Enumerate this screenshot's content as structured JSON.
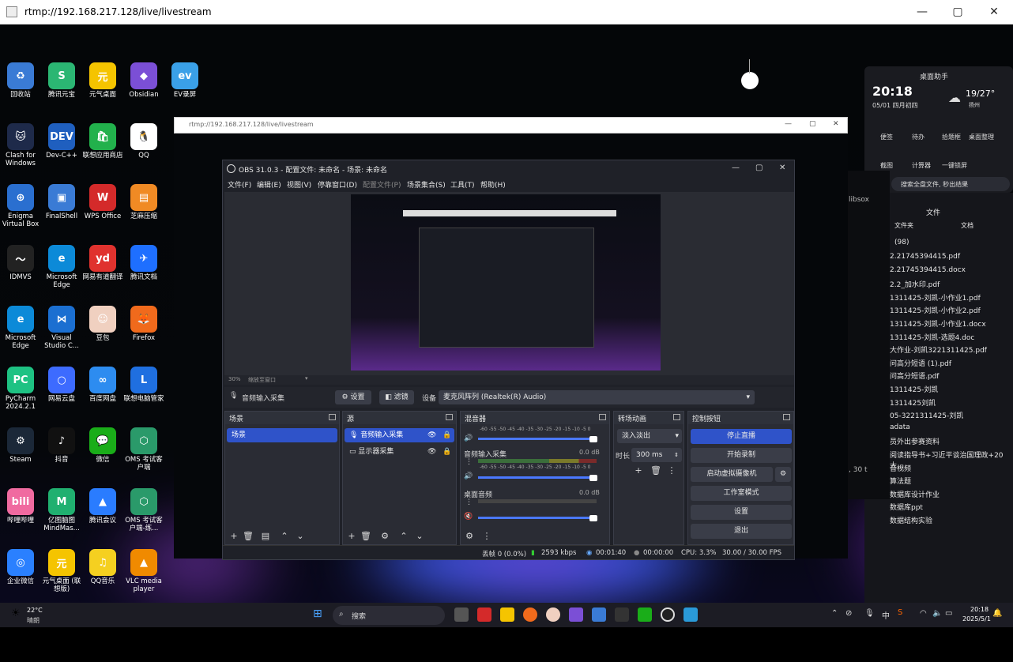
{
  "outer_window": {
    "title": "rtmp://192.168.217.128/live/livestream",
    "min": "—",
    "max": "▢",
    "close": "✕"
  },
  "desktop_icons": [
    {
      "label": "回收站",
      "color": "#3a7bd5",
      "glyph": "♻",
      "x": 0,
      "y": 0
    },
    {
      "label": "腾讯元宝",
      "color": "#2bb673",
      "glyph": "S"
    },
    {
      "label": "元气桌面",
      "color": "#f5c400",
      "glyph": "元"
    },
    {
      "label": "Obsidian",
      "color": "#7b4fd6",
      "glyph": "◆"
    },
    {
      "label": "EV录屏",
      "color": "#3aa0e8",
      "glyph": "ev"
    },
    {
      "label": "Clash for Windows",
      "color": "#1e2a4a",
      "glyph": "🐱"
    },
    {
      "label": "Dev-C++",
      "color": "#1f5fbf",
      "glyph": "DEV"
    },
    {
      "label": "联想应用商店",
      "color": "#22b14c",
      "glyph": "🛍"
    },
    {
      "label": "QQ",
      "color": "#ffffff",
      "glyph": "🐧"
    },
    {
      "label": "Enigma Virtual Box",
      "color": "#2a6fd0",
      "glyph": "⊕"
    },
    {
      "label": "FinalShell",
      "color": "#3a7bd5",
      "glyph": "▣"
    },
    {
      "label": "WPS Office",
      "color": "#d42a2a",
      "glyph": "W"
    },
    {
      "label": "芝麻压缩",
      "color": "#f08a24",
      "glyph": "▤"
    },
    {
      "label": "IDMVS",
      "color": "#222",
      "glyph": "〜"
    },
    {
      "label": "Microsoft Edge",
      "color": "#0c8ad8",
      "glyph": "e"
    },
    {
      "label": "网易有道翻译",
      "color": "#e0322e",
      "glyph": "yd"
    },
    {
      "label": "腾讯文档",
      "color": "#1e6fff",
      "glyph": "✈"
    },
    {
      "label": "Microsoft Edge",
      "color": "#0c8ad8",
      "glyph": "e"
    },
    {
      "label": "Visual Studio C...",
      "color": "#1b6fd1",
      "glyph": "⋈"
    },
    {
      "label": "豆包",
      "color": "#f0d0c0",
      "glyph": "☺"
    },
    {
      "label": "Firefox",
      "color": "#f06a1c",
      "glyph": "🦊"
    },
    {
      "label": "PyCharm 2024.2.1",
      "color": "#1ec283",
      "glyph": "PC"
    },
    {
      "label": "网易云盘",
      "color": "#3d6bff",
      "glyph": "○"
    },
    {
      "label": "百度网盘",
      "color": "#2d8cf0",
      "glyph": "∞"
    },
    {
      "label": "联想电脑管家",
      "color": "#1f6fe0",
      "glyph": "L"
    },
    {
      "label": "Steam",
      "color": "#1b2838",
      "glyph": "⚙"
    },
    {
      "label": "抖音",
      "color": "#111",
      "glyph": "♪"
    },
    {
      "label": "微信",
      "color": "#1aad19",
      "glyph": "💬"
    },
    {
      "label": "OMS 考试客户端",
      "color": "#2a9a6a",
      "glyph": "⬡"
    },
    {
      "label": "哔哩哔哩",
      "color": "#f06aa0",
      "glyph": "bili"
    },
    {
      "label": "亿图脑图 MindMas...",
      "color": "#20b070",
      "glyph": "M"
    },
    {
      "label": "腾讯会议",
      "color": "#2a7cff",
      "glyph": "▲"
    },
    {
      "label": "OMS 考试客户端-练...",
      "color": "#2a9a6a",
      "glyph": "⬡"
    },
    {
      "label": "企业微信",
      "color": "#2a80ff",
      "glyph": "◎"
    },
    {
      "label": "元气桌面 (联想版)",
      "color": "#f5c400",
      "glyph": "元"
    },
    {
      "label": "QQ音乐",
      "color": "#f5d020",
      "glyph": "♫"
    },
    {
      "label": "VLC media player",
      "color": "#f08a00",
      "glyph": "▲"
    }
  ],
  "inner_window": {
    "title": "rtmp://192.168.217.128/live/livestream"
  },
  "obs": {
    "title": "OBS 31.0.3 - 配置文件: 未命名 - 场景: 未命名",
    "menu": [
      "文件(F)",
      "编辑(E)",
      "视图(V)",
      "停靠窗口(D)",
      "配置文件(P)",
      "场景集合(S)",
      "工具(T)",
      "帮助(H)"
    ],
    "zoom": "30%",
    "zoom_mode": "缩放至窗口",
    "source_name": "音频输入采集",
    "props_btn": "设置",
    "filters_btn": "滤镜",
    "device_label": "设备",
    "device_value": "麦克风阵列 (Realtek(R) Audio)",
    "scenes": {
      "title": "场景",
      "items": [
        "场景"
      ]
    },
    "sources": {
      "title": "源",
      "items": [
        "音频输入采集",
        "显示器采集"
      ]
    },
    "mixer": {
      "title": "混音器",
      "channels": [
        {
          "name": "",
          "db": ""
        },
        {
          "name": "音频输入采集",
          "db": "0.0 dB"
        },
        {
          "name": "桌面音频",
          "db": "0.0 dB"
        }
      ],
      "scale": "-60 -55 -50 -45 -40 -35 -30 -25 -20 -15 -10 -5 0"
    },
    "transitions": {
      "title": "转场动画",
      "type": "淡入淡出",
      "duration_label": "时长",
      "duration": "300 ms"
    },
    "controls": {
      "title": "控制按钮",
      "stop_stream": "停止直播",
      "start_record": "开始录制",
      "virtual_cam": "启动虚拟摄像机",
      "studio_mode": "工作室模式",
      "settings": "设置",
      "exit": "退出"
    },
    "status": {
      "dropped": "丢帧 0 (0.0%)",
      "bitrate": "2593 kbps",
      "stream_time": "00:01:40",
      "rec_time": "00:00:00",
      "cpu": "CPU: 3.3%",
      "fps": "30.00 / 30.00 FPS"
    }
  },
  "widget": {
    "title": "桌面助手",
    "time": "20:18",
    "date": "05/01 四月初四",
    "temp": "19/27°",
    "city": "扬州",
    "tools": [
      "便签",
      "待办",
      "拾题框",
      "桌面整理",
      "截图",
      "计算器",
      "一键锁屏"
    ],
    "search_placeholder": "搜索全盘文件, 秒出结果",
    "file_tabs": [
      "文件",
      "文件夹",
      "文档"
    ],
    "count": "(98)",
    "files": [
      "2.21745394415.pdf",
      "2.21745394415.docx",
      "2.2_加水印.pdf",
      "1311425-刘凯-小作业1.pdf",
      "1311425-刘凯-小作业2.pdf",
      "1311425-刘凯-小作业1.docx",
      "1311425-刘凯-选题4.doc",
      "大作业-刘凯3221311425.pdf",
      "问高分短语 (1).pdf",
      "问高分短语.pdf",
      "1311425-刘凯",
      "1311425刘凯",
      "05-3221311425-刘凯",
      "adata",
      "员外出参赛资料",
      "阅读指导书+习近平谈治国理政+20大...",
      "音视频",
      "算法题",
      "数据库设计作业",
      "数据库ppt",
      "数据结构实验"
    ],
    "vm_text": "libsox",
    "vm_text2": ", 30 t"
  },
  "taskbar": {
    "weather_temp": "22°C",
    "weather_desc": "晴朗",
    "search": "搜索",
    "ime": "中",
    "time": "20:18",
    "date": "2025/5/1"
  }
}
